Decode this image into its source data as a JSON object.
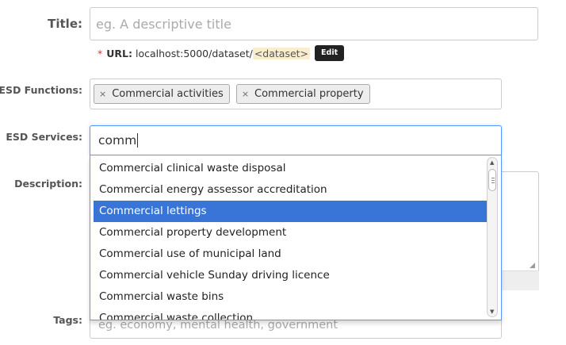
{
  "form": {
    "title": {
      "label": "Title:",
      "placeholder": "eg. A descriptive title"
    },
    "url": {
      "required_mark": "*",
      "label": "URL:",
      "prefix": "localhost:5000/dataset/",
      "slug": "<dataset>",
      "edit_label": "Edit"
    },
    "esd_functions": {
      "label": "ESD Functions:",
      "tags": [
        "Commercial activities",
        "Commercial property"
      ],
      "remove_glyph": "×"
    },
    "esd_services": {
      "label": "ESD Services:",
      "search_value": "comm",
      "options": [
        "Commercial clinical waste disposal",
        "Commercial energy assessor accreditation",
        "Commercial lettings",
        "Commercial property development",
        "Commercial use of municipal land",
        "Commercial vehicle Sunday driving licence",
        "Commercial waste bins",
        "Commercial waste collection"
      ],
      "highlighted_option": "Commercial lettings"
    },
    "description": {
      "label": "Description:"
    },
    "tags": {
      "label": "Tags:",
      "placeholder": "eg. economy, mental health, government"
    }
  },
  "colors": {
    "highlight": "#3875d7",
    "focus_border": "#5897fb",
    "required": "#c6383f",
    "edit_button": "#222222"
  }
}
